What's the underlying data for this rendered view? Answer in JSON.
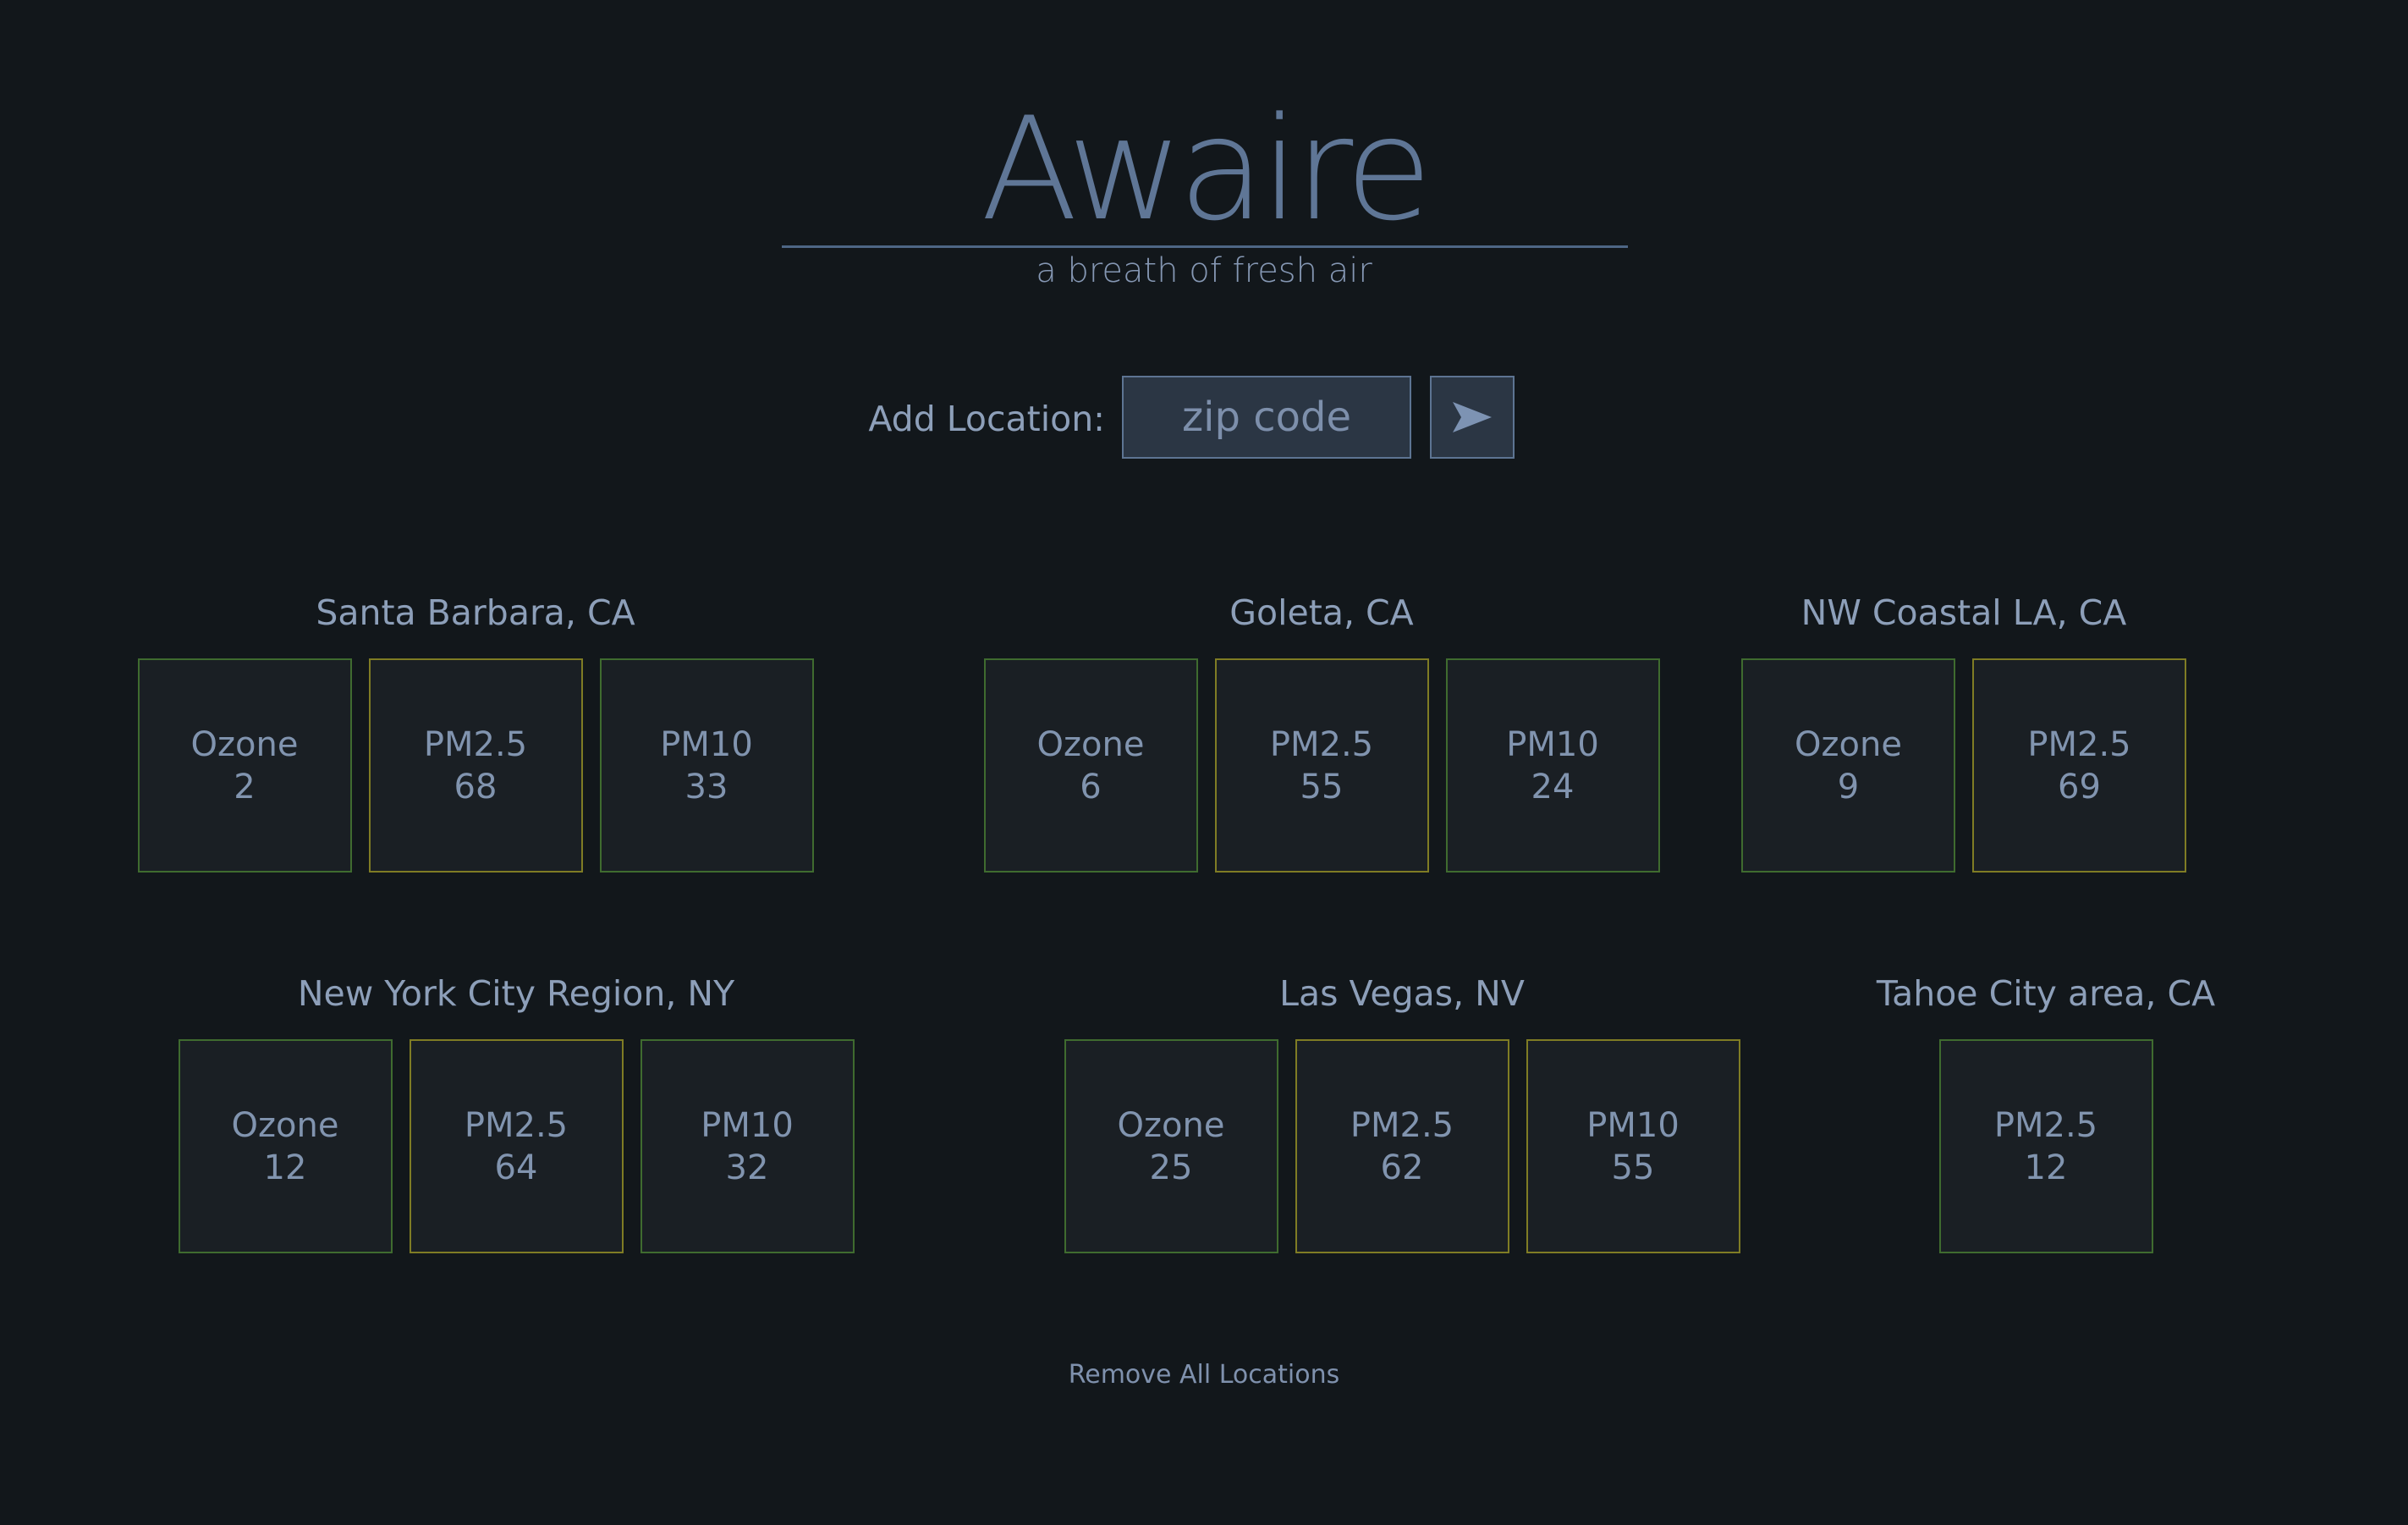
{
  "app": {
    "logo": "Awaire",
    "tagline": "a breath of fresh air"
  },
  "add_location": {
    "label": "Add Location:",
    "placeholder": "zip code",
    "submit_icon": "send-arrow-icon"
  },
  "locations": [
    {
      "name": "Santa Barbara, CA",
      "readings": [
        {
          "pollutant": "Ozone",
          "value": "2",
          "status": "good"
        },
        {
          "pollutant": "PM2.5",
          "value": "68",
          "status": "moderate"
        },
        {
          "pollutant": "PM10",
          "value": "33",
          "status": "good"
        }
      ]
    },
    {
      "name": "Goleta, CA",
      "readings": [
        {
          "pollutant": "Ozone",
          "value": "6",
          "status": "good"
        },
        {
          "pollutant": "PM2.5",
          "value": "55",
          "status": "moderate"
        },
        {
          "pollutant": "PM10",
          "value": "24",
          "status": "good"
        }
      ]
    },
    {
      "name": "NW Coastal LA, CA",
      "readings": [
        {
          "pollutant": "Ozone",
          "value": "9",
          "status": "good"
        },
        {
          "pollutant": "PM2.5",
          "value": "69",
          "status": "moderate"
        }
      ]
    },
    {
      "name": "New York City Region, NY",
      "readings": [
        {
          "pollutant": "Ozone",
          "value": "12",
          "status": "good"
        },
        {
          "pollutant": "PM2.5",
          "value": "64",
          "status": "moderate"
        },
        {
          "pollutant": "PM10",
          "value": "32",
          "status": "good"
        }
      ]
    },
    {
      "name": "Las Vegas, NV",
      "readings": [
        {
          "pollutant": "Ozone",
          "value": "25",
          "status": "good"
        },
        {
          "pollutant": "PM2.5",
          "value": "62",
          "status": "moderate"
        },
        {
          "pollutant": "PM10",
          "value": "55",
          "status": "moderate"
        }
      ]
    },
    {
      "name": "Tahoe City area, CA",
      "readings": [
        {
          "pollutant": "PM2.5",
          "value": "12",
          "status": "good"
        }
      ]
    }
  ],
  "remove_all_label": "Remove All Locations",
  "colors": {
    "background": "#12171b",
    "good": "#3f6b2f",
    "moderate": "#7f7c24",
    "text": "#8d9fb9",
    "accent": "#5f7696"
  }
}
